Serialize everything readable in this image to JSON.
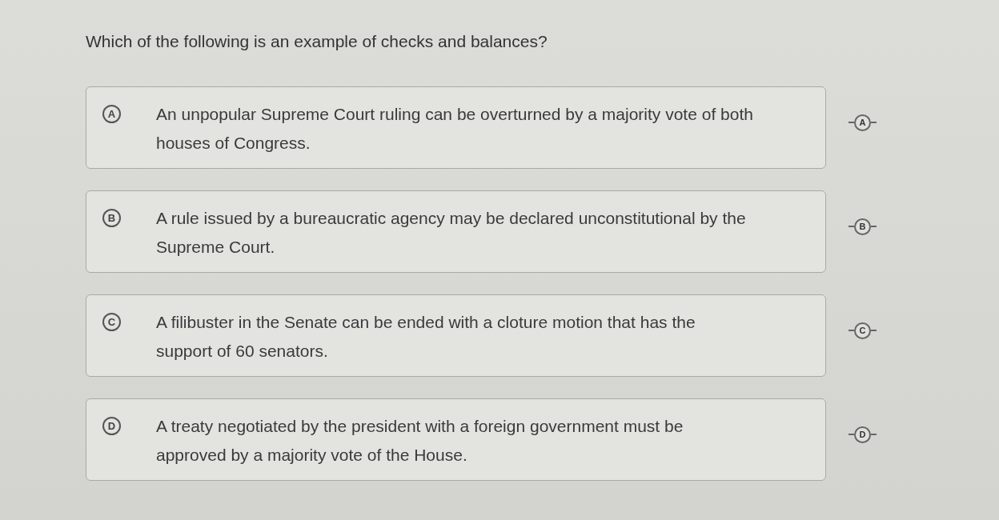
{
  "question": {
    "text": "Which of the following is an example of checks and balances?"
  },
  "choices": [
    {
      "letter": "A",
      "lines": [
        "An unpopular Supreme Court ruling can be overturned by a majority vote of both",
        "houses of Congress."
      ],
      "selected": false,
      "eliminator": "A"
    },
    {
      "letter": "B",
      "lines": [
        "A rule issued by a bureaucratic agency may be declared unconstitutional by the",
        "Supreme Court."
      ],
      "selected": false,
      "eliminator": "B"
    },
    {
      "letter": "C",
      "lines": [
        "A filibuster in the Senate can be ended with a cloture motion that has the",
        "support of 60 senators."
      ],
      "selected": false,
      "eliminator": "C"
    },
    {
      "letter": "D",
      "lines": [
        "A treaty negotiated by the president with a foreign government must be",
        "approved by a majority vote of the House."
      ],
      "selected": false,
      "eliminator": "D"
    }
  ]
}
